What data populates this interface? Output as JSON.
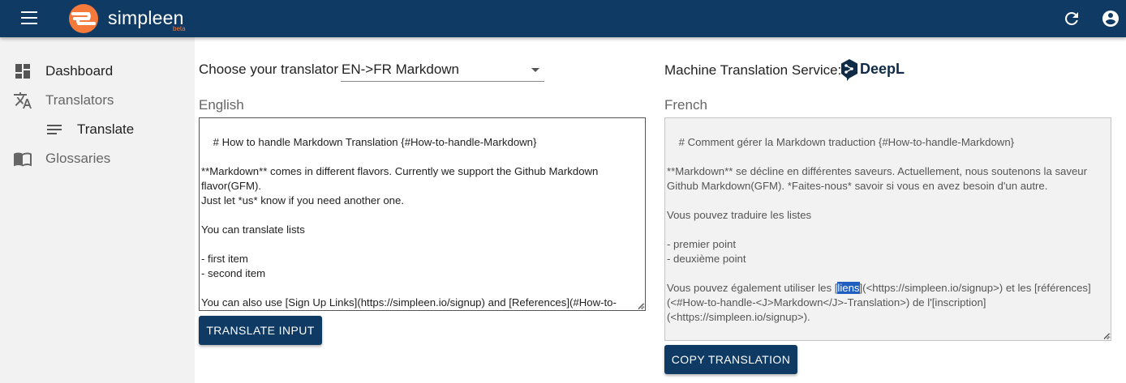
{
  "appbar": {
    "brand": "simpleen",
    "badge": "beta",
    "colors": {
      "bar": "#0f3a64",
      "logo": "#f4793a"
    },
    "icons": [
      "menu-icon",
      "refresh-icon",
      "account-icon"
    ]
  },
  "sidebar": {
    "items": [
      {
        "label": "Dashboard",
        "icon": "dashboard-icon"
      },
      {
        "label": "Translators",
        "icon": "translate-icon"
      },
      {
        "label": "Translate",
        "icon": "lines-icon"
      },
      {
        "label": "Glossaries",
        "icon": "book-icon"
      }
    ]
  },
  "chooser": {
    "label": "Choose your translator",
    "selected": "EN->FR Markdown"
  },
  "mt_service": {
    "label": "Machine Translation Service:",
    "provider": "DeepL"
  },
  "source": {
    "label": "English",
    "text": "# How to handle Markdown Translation {#How-to-handle-Markdown}\n\n**Markdown** comes in different flavors. Currently we support the Github Markdown flavor(GFM).\nJust let *us* know if you need another one.\n\nYou can translate lists\n\n- first item\n- second item\n\nYou can also use [Sign Up Links](https://simpleen.io/signup) and [References](#How-to-handle-Markdown-Translation).",
    "button": "TRANSLATE INPUT"
  },
  "target": {
    "label": "French",
    "text_before": "# Comment gérer la Markdown traduction {#How-to-handle-Markdown}\n\n**Markdown** se décline en différentes saveurs. Actuellement, nous soutenons la saveur Github Markdown(GFM). *Faites-nous* savoir si vous en avez besoin d'un autre.\n\nVous pouvez traduire les listes\n\n- premier point\n- deuxième point\n\nVous pouvez également utiliser les [",
    "selected_word": "liens",
    "text_after": "](<https://simpleen.io/signup>) et les [références](<#How-to-handle-<J>Markdown</J>-Translation>) de l'[inscription](<https://simpleen.io/signup>).",
    "button": "COPY TRANSLATION"
  }
}
